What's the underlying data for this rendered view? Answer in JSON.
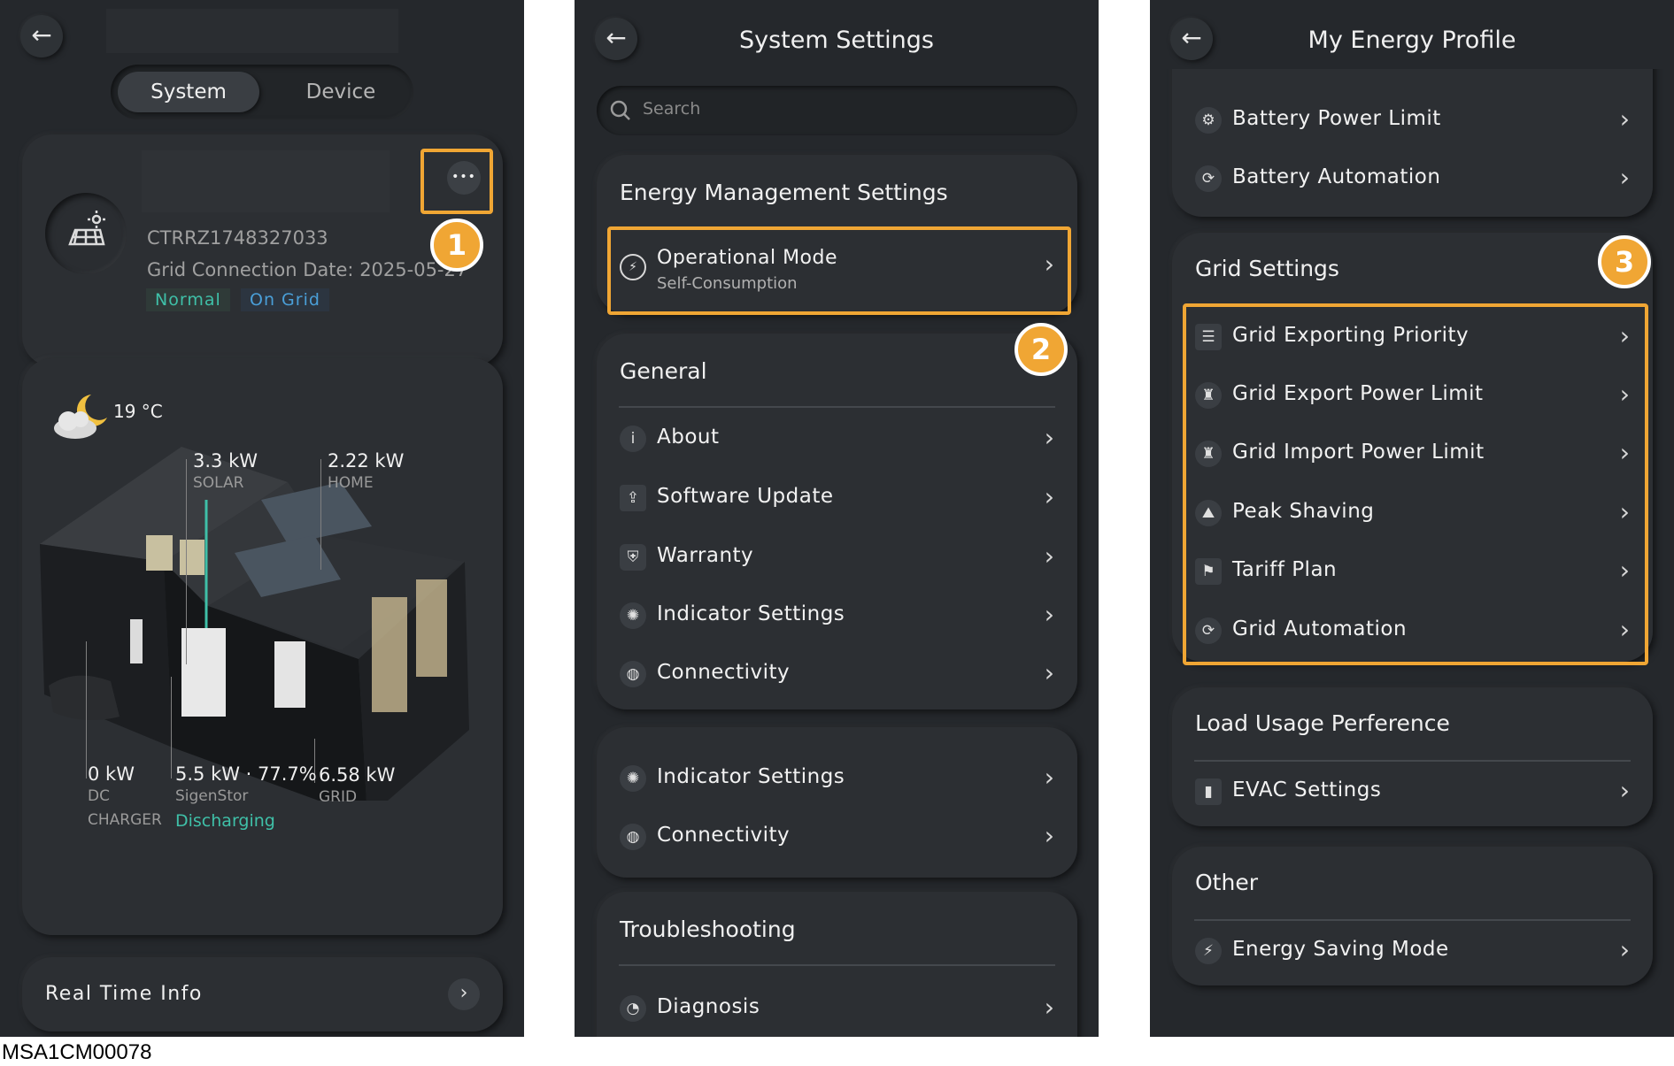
{
  "caption": "MSA1CM00078",
  "panel1": {
    "tabs": {
      "system": "System",
      "device": "Device"
    },
    "more_label": "•••",
    "callout": "1",
    "serial": "CTRRZ1748327033",
    "grid_connection": "Grid Connection Date: 2025-05-27",
    "status": [
      "Normal",
      "On Grid"
    ],
    "weather": "19 °C",
    "flows": {
      "solar": {
        "value": "3.3 kW",
        "label": "SOLAR"
      },
      "home": {
        "value": "2.22 kW",
        "label": "HOME"
      },
      "charger": {
        "value": "0 kW",
        "label1": "DC",
        "label2": "CHARGER"
      },
      "battery": {
        "value": "5.5 kW · 77.7%",
        "label": "SigenStor",
        "state": "Discharging"
      },
      "grid": {
        "value": "6.58 kW",
        "label": "GRID"
      }
    },
    "real_time_info": "Real Time Info"
  },
  "panel2": {
    "title": "System Settings",
    "search_placeholder": "Search",
    "callout": "2",
    "energy_mgmt": {
      "title": "Energy Management Settings",
      "op_mode": {
        "label": "Operational Mode",
        "sub": "Self-Consumption"
      }
    },
    "general": {
      "title": "General",
      "items": [
        "About",
        "Software Update",
        "Warranty",
        "Indicator Settings",
        "Connectivity"
      ]
    },
    "extra_items": [
      "Indicator Settings",
      "Connectivity"
    ],
    "troubleshooting": {
      "title": "Troubleshooting",
      "items": [
        "Diagnosis"
      ]
    }
  },
  "panel3": {
    "title": "My Energy Profile",
    "callout": "3",
    "battery_items": [
      "Battery Power Limit",
      "Battery Automation"
    ],
    "grid": {
      "title": "Grid Settings",
      "items": [
        "Grid Exporting Priority",
        "Grid Export Power Limit",
        "Grid Import Power Limit",
        "Peak Shaving",
        "Tariff Plan",
        "Grid Automation"
      ]
    },
    "load": {
      "title": "Load Usage Perference",
      "items": [
        "EVAC Settings"
      ]
    },
    "other": {
      "title": "Other",
      "items": [
        "Energy Saving Mode"
      ]
    }
  },
  "colors": {
    "highlight": "#f0a634",
    "teal": "#3fc0a8",
    "blue": "#4a9fd8",
    "panel": "#25282c"
  }
}
